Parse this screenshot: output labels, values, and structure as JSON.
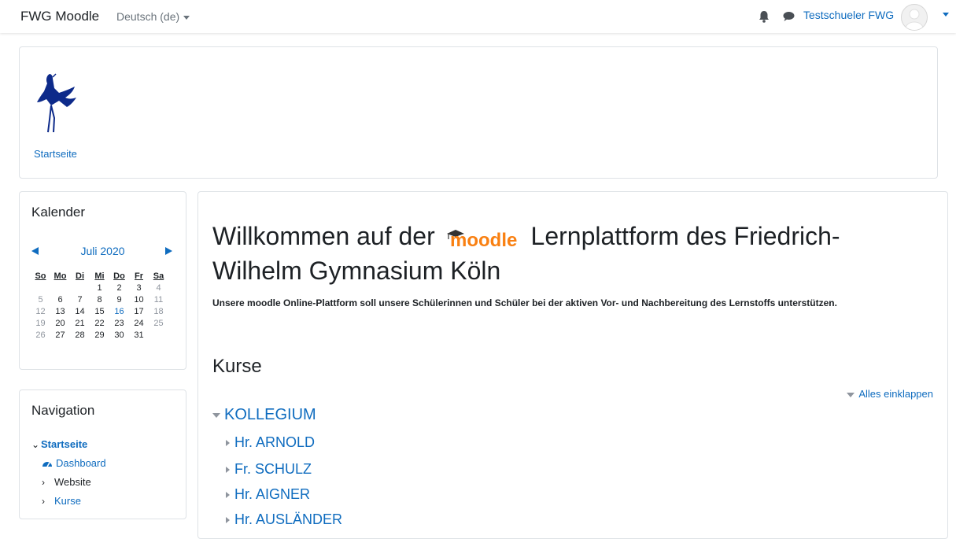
{
  "navbar": {
    "brand": "FWG Moodle",
    "language": "Deutsch (de)",
    "username": "Testschueler FWG"
  },
  "header": {
    "breadcrumb": "Startseite"
  },
  "calendar": {
    "title": "Kalender",
    "month": "Juli 2020",
    "weekdays": [
      "So",
      "Mo",
      "Di",
      "Mi",
      "Do",
      "Fr",
      "Sa"
    ],
    "today": "16",
    "weeks": [
      [
        "",
        "",
        "",
        "1",
        "2",
        "3",
        "4"
      ],
      [
        "5",
        "6",
        "7",
        "8",
        "9",
        "10",
        "11"
      ],
      [
        "12",
        "13",
        "14",
        "15",
        "16",
        "17",
        "18"
      ],
      [
        "19",
        "20",
        "21",
        "22",
        "23",
        "24",
        "25"
      ],
      [
        "26",
        "27",
        "28",
        "29",
        "30",
        "31",
        ""
      ]
    ]
  },
  "navigation": {
    "title": "Navigation",
    "root": "Startseite",
    "dashboard": "Dashboard",
    "website": "Website",
    "kurse": "Kurse"
  },
  "main": {
    "welcome_before": "Willkommen auf der",
    "moodle_logo_text": "moodle",
    "welcome_after": "Lernplattform des Friedrich-Wilhelm Gymnasium Köln",
    "intro": "Unsere moodle Online-Plattform soll unsere Schülerinnen und Schüler bei der aktiven Vor- und Nachbereitung des Lernstoffs unterstützen.",
    "courses_heading": "Kurse",
    "collapse_all": "Alles einklappen",
    "category": "KOLLEGIUM",
    "subcategories": [
      "Hr. ARNOLD",
      "Fr. SCHULZ",
      "Hr. AIGNER",
      "Hr. AUSLÄNDER"
    ]
  },
  "colors": {
    "link": "#0f6cbf",
    "moodle_orange": "#f98012",
    "logo_blue": "#0d2a8a"
  }
}
